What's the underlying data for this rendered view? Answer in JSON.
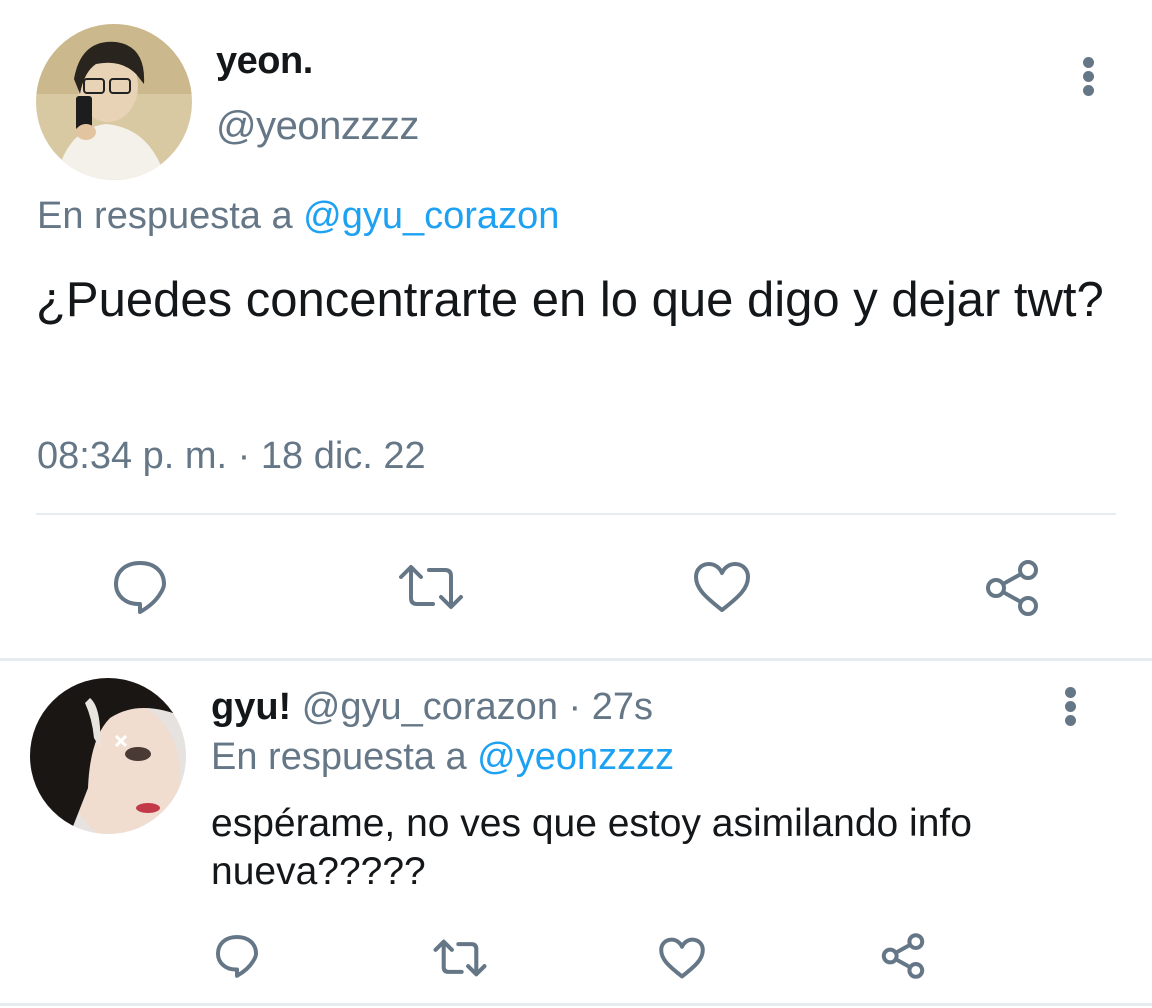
{
  "main_tweet": {
    "display_name": "yeon.",
    "handle": "@yeonzzzz",
    "reply_prefix": "En respuesta a",
    "reply_to": "@gyu_corazon",
    "text": "¿Puedes concentrarte en lo que digo y dejar twt?",
    "timestamp": "08:34 p. m. · 18 dic. 22"
  },
  "reply_tweet": {
    "display_name": "gyu!",
    "handle": "@gyu_corazon",
    "separator": "·",
    "time_ago": "27s",
    "reply_prefix": "En respuesta a",
    "reply_to": "@yeonzzzz",
    "text": "espérame, no ves que estoy asimilando info nueva?????"
  },
  "actions": [
    "reply-icon",
    "retweet-icon",
    "like-icon",
    "share-icon"
  ],
  "colors": {
    "text_primary": "#14171a",
    "text_secondary": "#657786",
    "link": "#1da1f2",
    "divider": "#e6ecf0"
  }
}
